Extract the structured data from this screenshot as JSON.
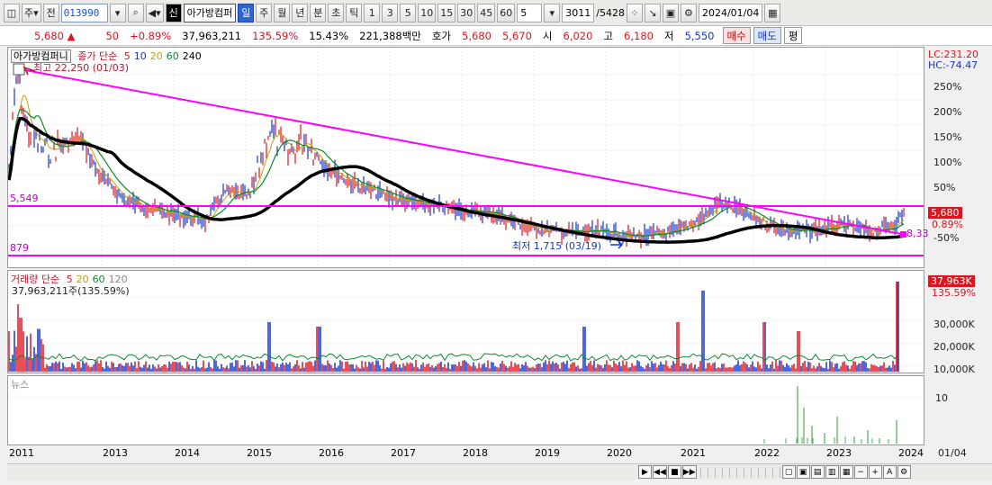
{
  "toolbar": {
    "b1": "주",
    "b2": "전",
    "code": "013990",
    "name": "아가방컴퍼",
    "tag": "신",
    "periods": [
      "일",
      "주",
      "월",
      "년",
      "분",
      "초",
      "틱"
    ],
    "minutes": [
      "1",
      "3",
      "5",
      "10",
      "15",
      "30",
      "45",
      "60"
    ],
    "count": "5",
    "bars": "3011",
    "total": "/5428",
    "date": "2024/01/04"
  },
  "quote": {
    "price": "5,680",
    "change": "50",
    "pct": "+0.89%",
    "volume": "37,963,211",
    "vol_pct": "135.59%",
    "turnover": "15.43%",
    "amount": "221,388백만",
    "hoga_label": "호가",
    "ask": "5,680",
    "bid": "5,670",
    "open_label": "시",
    "open": "6,020",
    "high_label": "고",
    "high": "6,180",
    "low_label": "저",
    "low": "5,550",
    "buy": "매수",
    "sell": "매도",
    "avg": "평"
  },
  "price_panel": {
    "title": "아가방컴퍼니",
    "legend_label": "종가 단순",
    "ma": [
      {
        "label": "5",
        "color": "#e0141e"
      },
      {
        "label": "10",
        "color": "#1434d2"
      },
      {
        "label": "20",
        "color": "#c8a000"
      },
      {
        "label": "60",
        "color": "#0a8a2a"
      },
      {
        "label": "240",
        "color": "#000000"
      }
    ],
    "high_note": "최고 22,250 (01/03)",
    "low_note": "최저 1,715 (03/19)",
    "line1": "5,549",
    "line2": "879",
    "right_val": "8,33",
    "lc": "LC:231.20",
    "hc": "HC:-74.47",
    "cur_price": "5,680",
    "cur_pct": "0.89%",
    "pct_ticks": [
      "250%",
      "200%",
      "150%",
      "100%",
      "50%",
      "0%",
      "-50%"
    ]
  },
  "volume_panel": {
    "legend_label": "거래량 단순",
    "ma": [
      {
        "label": "5",
        "color": "#e0141e"
      },
      {
        "label": "20",
        "color": "#c8a000"
      },
      {
        "label": "60",
        "color": "#0a8a2a"
      },
      {
        "label": "120",
        "color": "#888888"
      }
    ],
    "volume_note": "37,963,211주(135.59%)",
    "cur": "37,963K",
    "cur_pct": "135.59%",
    "ticks": [
      "30,000K",
      "20,000K",
      "10,000K"
    ]
  },
  "news_panel": {
    "label": "뉴스",
    "tick": "10"
  },
  "xaxis": {
    "years": [
      "2011",
      "2013",
      "2014",
      "2015",
      "2016",
      "2017",
      "2018",
      "2019",
      "2020",
      "2021",
      "2022",
      "2023",
      "2024"
    ],
    "right": "01/04"
  },
  "colors": {
    "trend": "#ff00ff",
    "up": "#e0141e",
    "down": "#1434d2"
  }
}
